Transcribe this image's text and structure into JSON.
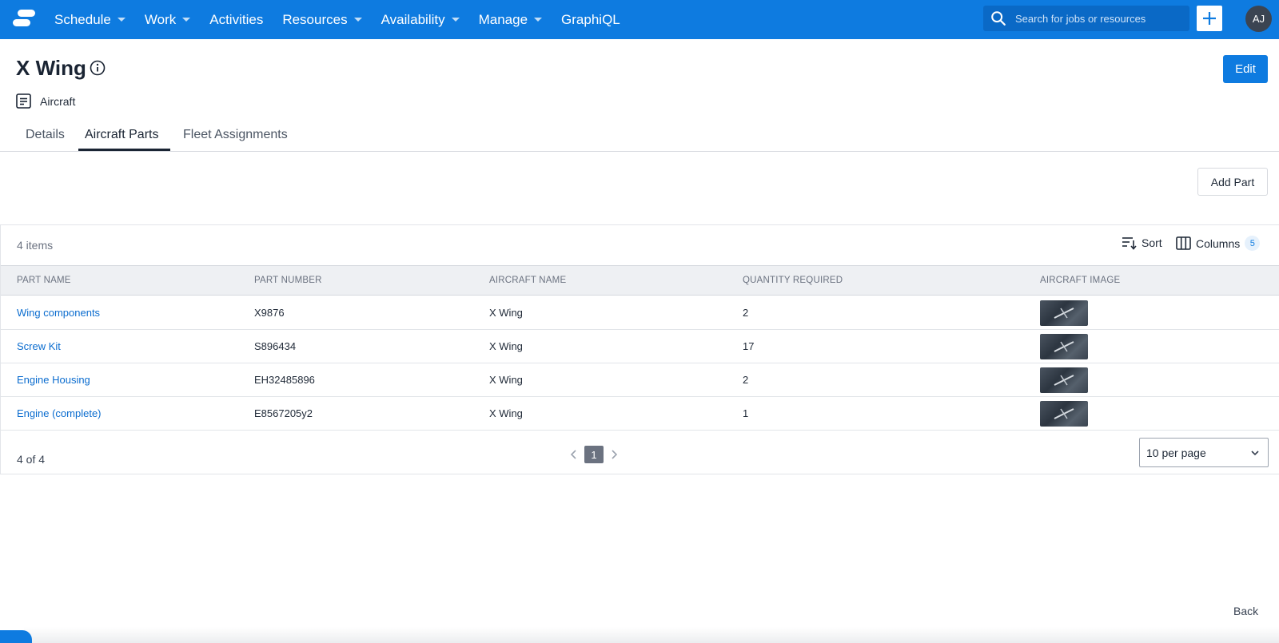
{
  "nav": {
    "items": [
      {
        "label": "Schedule",
        "dropdown": true
      },
      {
        "label": "Work",
        "dropdown": true
      },
      {
        "label": "Activities",
        "dropdown": false
      },
      {
        "label": "Resources",
        "dropdown": true
      },
      {
        "label": "Availability",
        "dropdown": true
      },
      {
        "label": "Manage",
        "dropdown": true
      },
      {
        "label": "GraphiQL",
        "dropdown": false
      }
    ],
    "search_placeholder": "Search for jobs or resources",
    "avatar_initials": "AJ",
    "brand_color": "#0e7be0"
  },
  "header": {
    "title": "X Wing",
    "type_label": "Aircraft",
    "edit_label": "Edit"
  },
  "tabs": [
    {
      "label": "Details",
      "active": false
    },
    {
      "label": "Aircraft Parts",
      "active": true
    },
    {
      "label": "Fleet Assignments",
      "active": false
    }
  ],
  "actions": {
    "add_part_label": "Add Part"
  },
  "table": {
    "items_count": "4 items",
    "sort_label": "Sort",
    "columns_label": "Columns",
    "columns_count": "5",
    "headers": [
      "PART NAME",
      "PART NUMBER",
      "AIRCRAFT NAME",
      "QUANTITY REQUIRED",
      "AIRCRAFT IMAGE"
    ],
    "rows": [
      {
        "part_name": "Wing components",
        "part_number": "X9876",
        "aircraft_name": "X Wing",
        "quantity": "2"
      },
      {
        "part_name": "Screw Kit",
        "part_number": "S896434",
        "aircraft_name": "X Wing",
        "quantity": "17"
      },
      {
        "part_name": "Engine Housing",
        "part_number": "EH32485896",
        "aircraft_name": "X Wing",
        "quantity": "2"
      },
      {
        "part_name": "Engine (complete)",
        "part_number": "E8567205y2",
        "aircraft_name": "X Wing",
        "quantity": "1"
      }
    ],
    "pagination_text": "4 of 4",
    "current_page": "1",
    "per_page": "10 per page"
  },
  "footer": {
    "back_label": "Back"
  }
}
